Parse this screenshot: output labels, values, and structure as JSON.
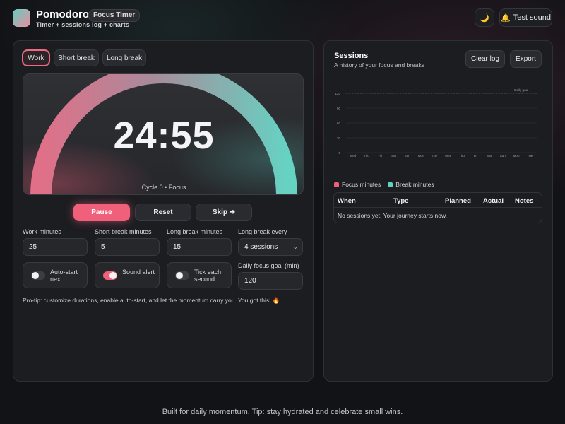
{
  "app": {
    "title": "Pomodoro",
    "badge": "Focus Timer",
    "subtitle": "Timer + sessions log + charts"
  },
  "header": {
    "theme_icon": "moon-icon",
    "theme_glyph": "🌙",
    "sound_icon": "bell-icon",
    "sound_glyph": "🔔",
    "sound_label": "Test sound"
  },
  "modes": [
    {
      "label": "Work",
      "active": true
    },
    {
      "label": "Short break",
      "active": false
    },
    {
      "label": "Long break",
      "active": false
    }
  ],
  "timer": {
    "display": "24:55",
    "cycle_label": "Cycle 0 • Focus",
    "progress": 0.997
  },
  "controls": {
    "pause": "Pause",
    "reset": "Reset",
    "skip": "Skip ➜"
  },
  "settings": {
    "work_label": "Work minutes",
    "work_value": "25",
    "short_label": "Short break minutes",
    "short_value": "5",
    "long_label": "Long break minutes",
    "long_value": "15",
    "every_label": "Long break every",
    "every_value": "4 sessions",
    "auto_start_label": "Auto-start next",
    "auto_start_on": false,
    "sound_alert_label": "Sound alert",
    "sound_alert_on": true,
    "tick_label": "Tick each second",
    "tick_on": false,
    "goal_label": "Daily focus goal (min)",
    "goal_value": "120"
  },
  "pro_tip": "Pro-tip: customize durations, enable auto-start, and let the momentum carry you. You got this! 🔥",
  "sessions": {
    "title": "Sessions",
    "subtitle": "A history of your focus and breaks",
    "clear_label": "Clear log",
    "export_label": "Export",
    "legend_focus": "Focus minutes",
    "legend_break": "Break minutes",
    "table_headers": [
      "When",
      "Type",
      "Planned",
      "Actual",
      "Notes"
    ],
    "empty_message": "No sessions yet. Your journey starts now."
  },
  "chart_data": {
    "type": "bar",
    "categories": [
      "Wed",
      "Thu",
      "Fri",
      "Sat",
      "Sun",
      "Mon",
      "Tue",
      "Wed",
      "Thu",
      "Fri",
      "Sat",
      "Sun",
      "Mon",
      "Tue"
    ],
    "series": [
      {
        "name": "Focus minutes",
        "values": [
          0,
          0,
          0,
          0,
          0,
          0,
          0,
          0,
          0,
          0,
          0,
          0,
          0,
          0
        ],
        "color": "#f0607a"
      },
      {
        "name": "Break minutes",
        "values": [
          0,
          0,
          0,
          0,
          0,
          0,
          0,
          0,
          0,
          0,
          0,
          0,
          0,
          0
        ],
        "color": "#5fd3c3"
      }
    ],
    "yticks": [
      0,
      30,
      60,
      90,
      120
    ],
    "ylim": [
      0,
      120
    ],
    "goal_line": 120,
    "goal_label": "Daily goal",
    "grid": true
  },
  "colors": {
    "accent": "#f0607a",
    "teal": "#5fd3c3"
  },
  "footer": "Built for daily momentum. Tip: stay hydrated and celebrate small wins."
}
